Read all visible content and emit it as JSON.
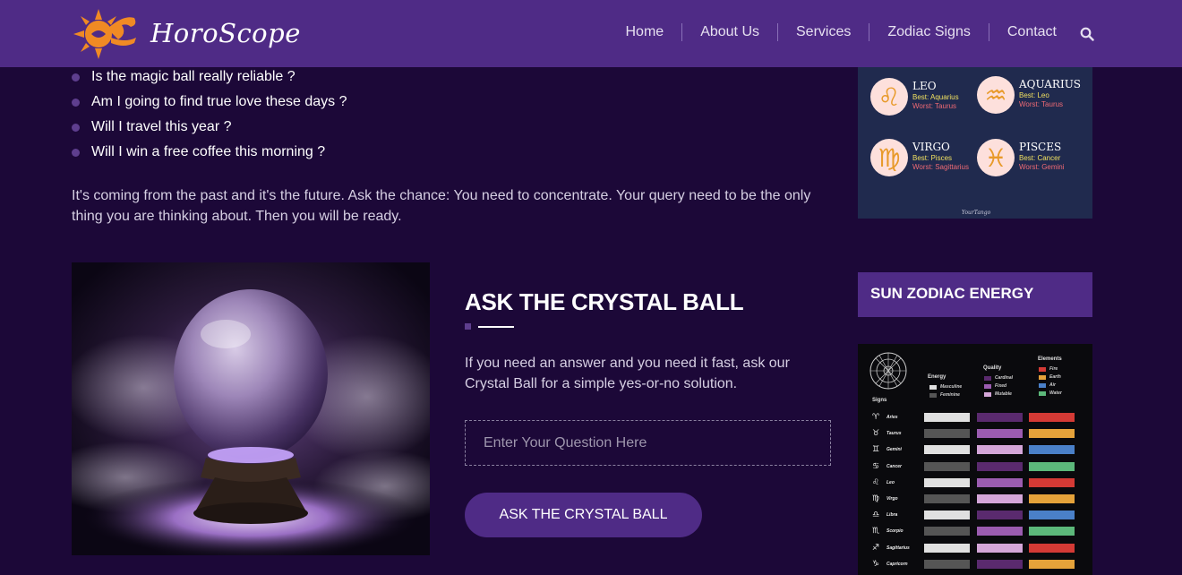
{
  "header": {
    "brand": "HoroScope",
    "nav": [
      "Home",
      "About Us",
      "Services",
      "Zodiac Signs",
      "Contact"
    ]
  },
  "questions": [
    "Is the magic ball really reliable ?",
    "Am I going to find true love these days ?",
    "Will I travel this year ?",
    "Will I win a free coffee this morning ?"
  ],
  "intro": "It's coming from the past and it's the future. Ask the chance: You need to concentrate. Your query need to be the only thing you are thinking about. Then you will be ready.",
  "ask": {
    "title": "ASK THE CRYSTAL BALL",
    "description": "If you need an answer and you need it fast, ask our Crystal Ball for a simple yes-or-no solution.",
    "placeholder": "Enter Your Question Here",
    "button": "ASK THE CRYSTAL BALL"
  },
  "zodiac_card": {
    "signs": [
      {
        "glyph": "♌",
        "name": "LEO",
        "best": "Best: Aquarius",
        "worst": "Worst: Taurus"
      },
      {
        "glyph": "♒",
        "name": "AQUARIUS",
        "best": "Best: Leo",
        "worst": "Worst: Taurus"
      },
      {
        "glyph": "♍",
        "name": "VIRGO",
        "best": "Best: Pisces",
        "worst": "Worst: Sagittarius"
      },
      {
        "glyph": "♓",
        "name": "PISCES",
        "best": "Best: Cancer",
        "worst": "Worst: Gemini"
      }
    ],
    "signature": "YourTango"
  },
  "sidebar": {
    "energy_title": "SUN ZODIAC ENERGY"
  },
  "energy_chart": {
    "labels": {
      "signs": "Signs",
      "energy": "Energy",
      "quality": "Quality",
      "elements": "Elements"
    },
    "energy_legend": [
      {
        "name": "Masculine",
        "color": "#e0e0e0"
      },
      {
        "name": "Feminine",
        "color": "#555555"
      }
    ],
    "quality_legend": [
      {
        "name": "Cardinal",
        "color": "#5a2a6e"
      },
      {
        "name": "Fixed",
        "color": "#9b5cb0"
      },
      {
        "name": "Mutable",
        "color": "#d4a6d8"
      }
    ],
    "elements_legend": [
      {
        "name": "Fire",
        "color": "#d43a35"
      },
      {
        "name": "Earth",
        "color": "#e5a23a"
      },
      {
        "name": "Air",
        "color": "#4a80c8"
      },
      {
        "name": "Water",
        "color": "#5cb87a"
      }
    ],
    "rows": [
      {
        "glyph": "♈",
        "name": "Aries",
        "energy": "#e0e0e0",
        "quality": "#5a2a6e",
        "element": "#d43a35"
      },
      {
        "glyph": "♉",
        "name": "Taurus",
        "energy": "#555555",
        "quality": "#9b5cb0",
        "element": "#e5a23a"
      },
      {
        "glyph": "♊",
        "name": "Gemini",
        "energy": "#e0e0e0",
        "quality": "#d4a6d8",
        "element": "#4a80c8"
      },
      {
        "glyph": "♋",
        "name": "Cancer",
        "energy": "#555555",
        "quality": "#5a2a6e",
        "element": "#5cb87a"
      },
      {
        "glyph": "♌",
        "name": "Leo",
        "energy": "#e0e0e0",
        "quality": "#9b5cb0",
        "element": "#d43a35"
      },
      {
        "glyph": "♍",
        "name": "Virgo",
        "energy": "#555555",
        "quality": "#d4a6d8",
        "element": "#e5a23a"
      },
      {
        "glyph": "♎",
        "name": "Libra",
        "energy": "#e0e0e0",
        "quality": "#5a2a6e",
        "element": "#4a80c8"
      },
      {
        "glyph": "♏",
        "name": "Scorpio",
        "energy": "#555555",
        "quality": "#9b5cb0",
        "element": "#5cb87a"
      },
      {
        "glyph": "♐",
        "name": "Sagittarius",
        "energy": "#e0e0e0",
        "quality": "#d4a6d8",
        "element": "#d43a35"
      },
      {
        "glyph": "♑",
        "name": "Capricorn",
        "energy": "#555555",
        "quality": "#5a2a6e",
        "element": "#e5a23a"
      }
    ]
  },
  "colors": {
    "header_bg": "#4f2b86",
    "page_bg": "#1c0838",
    "accent": "#5e3e8e",
    "logo_orange": "#f08a24"
  },
  "icons": {
    "logo": "scorpion-sun-icon",
    "search": "search-icon"
  }
}
